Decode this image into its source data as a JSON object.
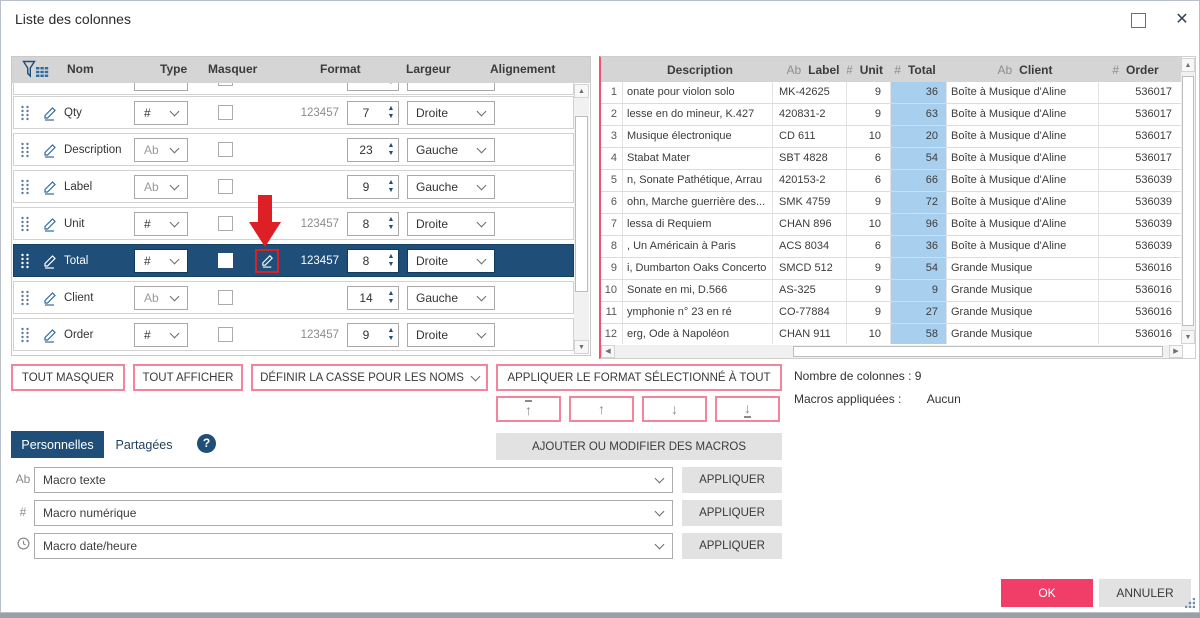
{
  "window": {
    "title": "Liste des colonnes"
  },
  "colors": {
    "accent_navy": "#1f4e79",
    "accent_pink": "#f13e68",
    "pink_border": "#f4849e",
    "red_annotation": "#dd1f26",
    "highlight_blue": "#a9cfef",
    "header_gray": "#d5d5d5"
  },
  "left_table": {
    "headers": {
      "nom": "Nom",
      "type": "Type",
      "masquer": "Masquer",
      "format": "Format",
      "largeur": "Largeur",
      "alignement": "Alignement"
    },
    "rows": [
      {
        "name": "Qty",
        "type": "#",
        "format": "123457",
        "width": "7",
        "align": "Droite",
        "selected": false
      },
      {
        "name": "Description",
        "type": "Ab",
        "format": "",
        "width": "23",
        "align": "Gauche",
        "selected": false
      },
      {
        "name": "Label",
        "type": "Ab",
        "format": "",
        "width": "9",
        "align": "Gauche",
        "selected": false
      },
      {
        "name": "Unit",
        "type": "#",
        "format": "123457",
        "width": "8",
        "align": "Droite",
        "selected": false
      },
      {
        "name": "Total",
        "type": "#",
        "format": "123457",
        "width": "8",
        "align": "Droite",
        "selected": true
      },
      {
        "name": "Client",
        "type": "Ab",
        "format": "",
        "width": "14",
        "align": "Gauche",
        "selected": false
      },
      {
        "name": "Order",
        "type": "#",
        "format": "123457",
        "width": "9",
        "align": "Droite",
        "selected": false
      }
    ]
  },
  "right_grid": {
    "headers": [
      {
        "glyph": "",
        "label": "Description"
      },
      {
        "glyph": "Ab",
        "label": "Label"
      },
      {
        "glyph": "#",
        "label": "Unit"
      },
      {
        "glyph": "#",
        "label": "Total"
      },
      {
        "glyph": "Ab",
        "label": "Client"
      },
      {
        "glyph": "#",
        "label": "Order"
      }
    ],
    "rows": [
      [
        "1",
        "onate pour violon solo",
        "MK-42625",
        "9",
        "36",
        "Boîte à Musique d'Aline",
        "536017"
      ],
      [
        "2",
        "lesse en do mineur, K.427",
        "420831-2",
        "9",
        "63",
        "Boîte à Musique d'Aline",
        "536017"
      ],
      [
        "3",
        "Musique électronique",
        "CD 611",
        "10",
        "20",
        "Boîte à Musique d'Aline",
        "536017"
      ],
      [
        "4",
        "Stabat Mater",
        "SBT 4828",
        "6",
        "54",
        "Boîte à Musique d'Aline",
        "536017"
      ],
      [
        "5",
        "n, Sonate Pathétique, Arrau",
        "420153-2",
        "6",
        "66",
        "Boîte à Musique d'Aline",
        "536039"
      ],
      [
        "6",
        "ohn, Marche guerrière des...",
        "SMK 4759",
        "9",
        "72",
        "Boîte à Musique d'Aline",
        "536039"
      ],
      [
        "7",
        "lessa di Requiem",
        "CHAN 896",
        "10",
        "96",
        "Boîte à Musique d'Aline",
        "536039"
      ],
      [
        "8",
        ", Un Américain à Paris",
        "ACS 8034",
        "6",
        "36",
        "Boîte à Musique d'Aline",
        "536039"
      ],
      [
        "9",
        "i, Dumbarton Oaks Concerto",
        "SMCD 512",
        "9",
        "54",
        "Grande Musique",
        "536016"
      ],
      [
        "10",
        "Sonate en mi, D.566",
        "AS-325",
        "9",
        "9",
        "Grande Musique",
        "536016"
      ],
      [
        "11",
        "ymphonie n° 23 en ré",
        "CO-77884",
        "9",
        "27",
        "Grande Musique",
        "536016"
      ],
      [
        "12",
        "erg, Ode à Napoléon",
        "CHAN 911",
        "10",
        "58",
        "Grande Musique",
        "536016"
      ]
    ]
  },
  "toolbar": {
    "hide_all": "TOUT MASQUER",
    "show_all": "TOUT AFFICHER",
    "set_case": "DÉFINIR LA CASSE POUR LES NOMS",
    "apply_format": "APPLIQUER LE FORMAT SÉLECTIONNÉ À TOUT",
    "move_top": "↑",
    "move_up": "↑",
    "move_down": "↓",
    "move_bottom": "↓"
  },
  "info": {
    "count_label": "Nombre de colonnes :",
    "count_value": "9",
    "macros_label": "Macros appliquées :",
    "macros_value": "Aucun"
  },
  "tabs": {
    "personal": "Personnelles",
    "shared": "Partagées",
    "help": "?"
  },
  "macros": {
    "add_or_edit": "AJOUTER OU MODIFIER DES MACROS",
    "apply": "APPLIQUER",
    "text_glyph": "Ab",
    "numeric_glyph": "#",
    "text": "Macro texte",
    "numeric": "Macro numérique",
    "datetime": "Macro date/heure"
  },
  "footer": {
    "ok": "OK",
    "cancel": "ANNULER"
  }
}
